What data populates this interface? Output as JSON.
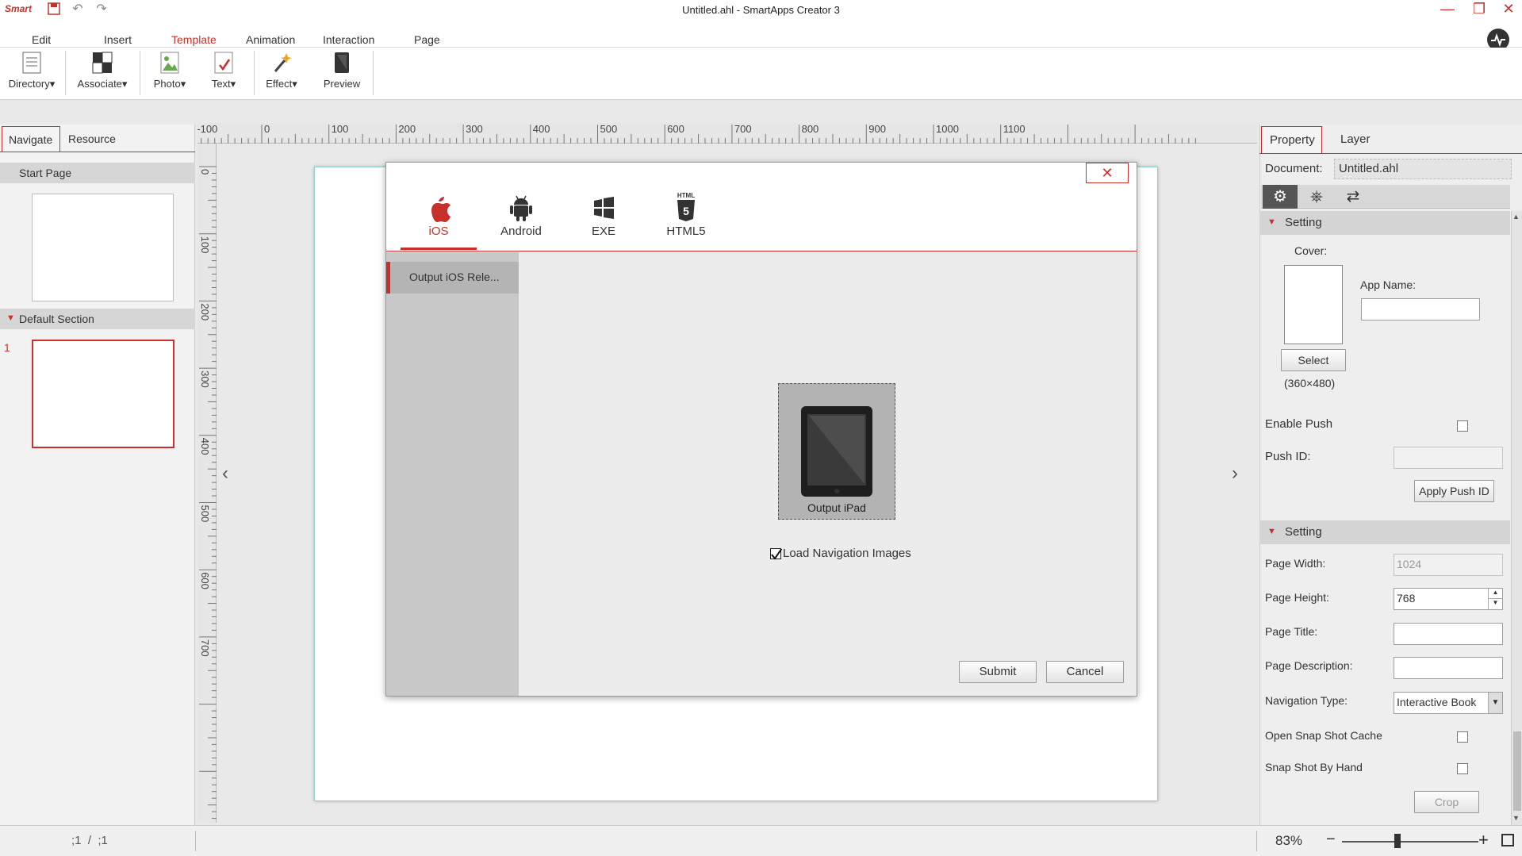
{
  "app": {
    "logo_text": "Smart",
    "title": "Untitled.ahl - SmartApps Creator 3"
  },
  "menu": {
    "items": [
      "Edit",
      "Insert",
      "Template",
      "Animation",
      "Interaction",
      "Page"
    ],
    "active": "Template"
  },
  "toolbar": {
    "directory": "Directory",
    "associate": "Associate",
    "photo": "Photo",
    "text": "Text",
    "effect": "Effect",
    "preview": "Preview",
    "dropdown_glyph": "▾"
  },
  "left_panel": {
    "tabs": [
      "Navigate",
      "Resource"
    ],
    "start_page": "Start Page",
    "section": "Default Section",
    "page_number": "1"
  },
  "ruler": {
    "h_labels": [
      "-100",
      "0",
      "100",
      "200",
      "300",
      "400",
      "500",
      "600",
      "700",
      "800",
      "900",
      "1000",
      "1100"
    ],
    "v_labels": [
      "0",
      "100",
      "200",
      "300",
      "400",
      "500",
      "600",
      "700"
    ]
  },
  "publish_dialog": {
    "close_glyph": "✕",
    "platform_tabs": [
      "iOS",
      "Android",
      "EXE",
      "HTML5"
    ],
    "active_platform": "iOS",
    "html5_badge": "HTML",
    "side_item": "Output iOS Rele...",
    "device_label": "Output iPad",
    "load_nav_images_label": "Load Navigation Images",
    "load_nav_images_checked": true,
    "submit_label": "Submit",
    "cancel_label": "Cancel"
  },
  "right_panel": {
    "tabs": [
      "Property",
      "Layer"
    ],
    "document_label": "Document:",
    "document_value": "Untitled.ahl",
    "setting1_title": "Setting",
    "cover_label": "Cover:",
    "app_name_label": "App Name:",
    "app_name_value": "",
    "select_label": "Select",
    "cover_size": "(360×480)",
    "enable_push_label": "Enable Push",
    "push_id_label": "Push ID:",
    "apply_push_label": "Apply Push ID",
    "setting2_title": "Setting",
    "page_width_label": "Page Width:",
    "page_width_value": "1024",
    "page_height_label": "Page Height:",
    "page_height_value": "768",
    "page_title_label": "Page Title:",
    "page_description_label": "Page Description:",
    "navigation_type_label": "Navigation Type:",
    "navigation_type_value": "Interactive Book",
    "open_snapshot_label": "Open Snap Shot Cache",
    "snapshot_hand_label": "Snap Shot By Hand",
    "crop_label": "Crop"
  },
  "status_bar": {
    "page_indicator": ";1  /  ;1",
    "zoom": "83%",
    "zoom_minus": "−",
    "zoom_plus": "+"
  },
  "colors": {
    "accent": "#c8312b",
    "canvas_border": "#8fd4c9"
  }
}
